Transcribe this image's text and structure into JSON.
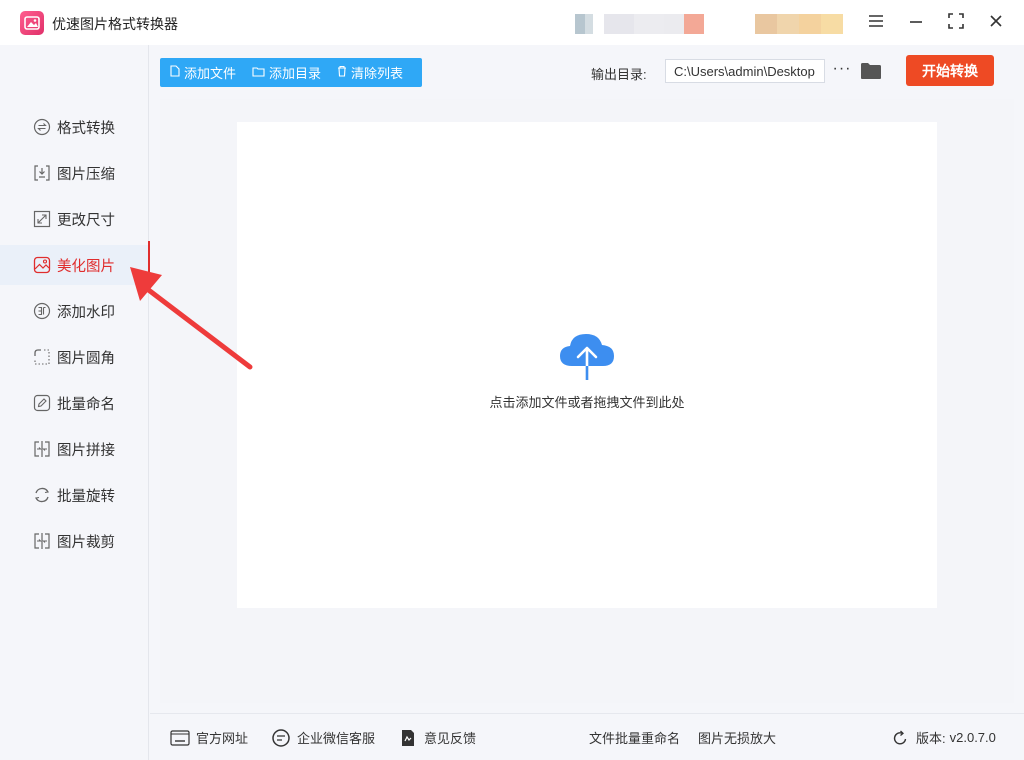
{
  "app": {
    "title": "优速图片格式转换器"
  },
  "window": {
    "menu_icon": "menu-icon",
    "minimize_icon": "minimize-icon",
    "maximize_icon": "maximize-icon",
    "close_icon": "close-icon"
  },
  "sidebar": {
    "items": [
      {
        "label": "格式转换",
        "icon": "swap-circle-icon",
        "active": false
      },
      {
        "label": "图片压缩",
        "icon": "compress-icon",
        "active": false
      },
      {
        "label": "更改尺寸",
        "icon": "resize-icon",
        "active": false
      },
      {
        "label": "美化图片",
        "icon": "beautify-icon",
        "active": true
      },
      {
        "label": "添加水印",
        "icon": "watermark-icon",
        "active": false
      },
      {
        "label": "图片圆角",
        "icon": "rounded-corner-icon",
        "active": false
      },
      {
        "label": "批量命名",
        "icon": "rename-icon",
        "active": false
      },
      {
        "label": "图片拼接",
        "icon": "stitch-icon",
        "active": false
      },
      {
        "label": "批量旋转",
        "icon": "rotate-icon",
        "active": false
      },
      {
        "label": "图片裁剪",
        "icon": "crop-icon",
        "active": false
      }
    ]
  },
  "toolbar": {
    "add_file": "添加文件",
    "add_folder": "添加目录",
    "clear_list": "清除列表",
    "output_label": "输出目录:",
    "output_path": "C:\\Users\\admin\\Desktop",
    "more": "···",
    "start": "开始转换"
  },
  "drop": {
    "hint": "点击添加文件或者拖拽文件到此处"
  },
  "footer": {
    "website": "官方网址",
    "wechat": "企业微信客服",
    "feedback": "意见反馈",
    "batch_rename": "文件批量重命名",
    "lossless": "图片无损放大",
    "version_label": "版本:",
    "version": "v2.0.7.0"
  },
  "colors": {
    "accent_blue": "#2fa8f6",
    "start_red": "#ee4a24",
    "active_red": "#e02d2d",
    "annotation_red": "#ee3b3b"
  }
}
